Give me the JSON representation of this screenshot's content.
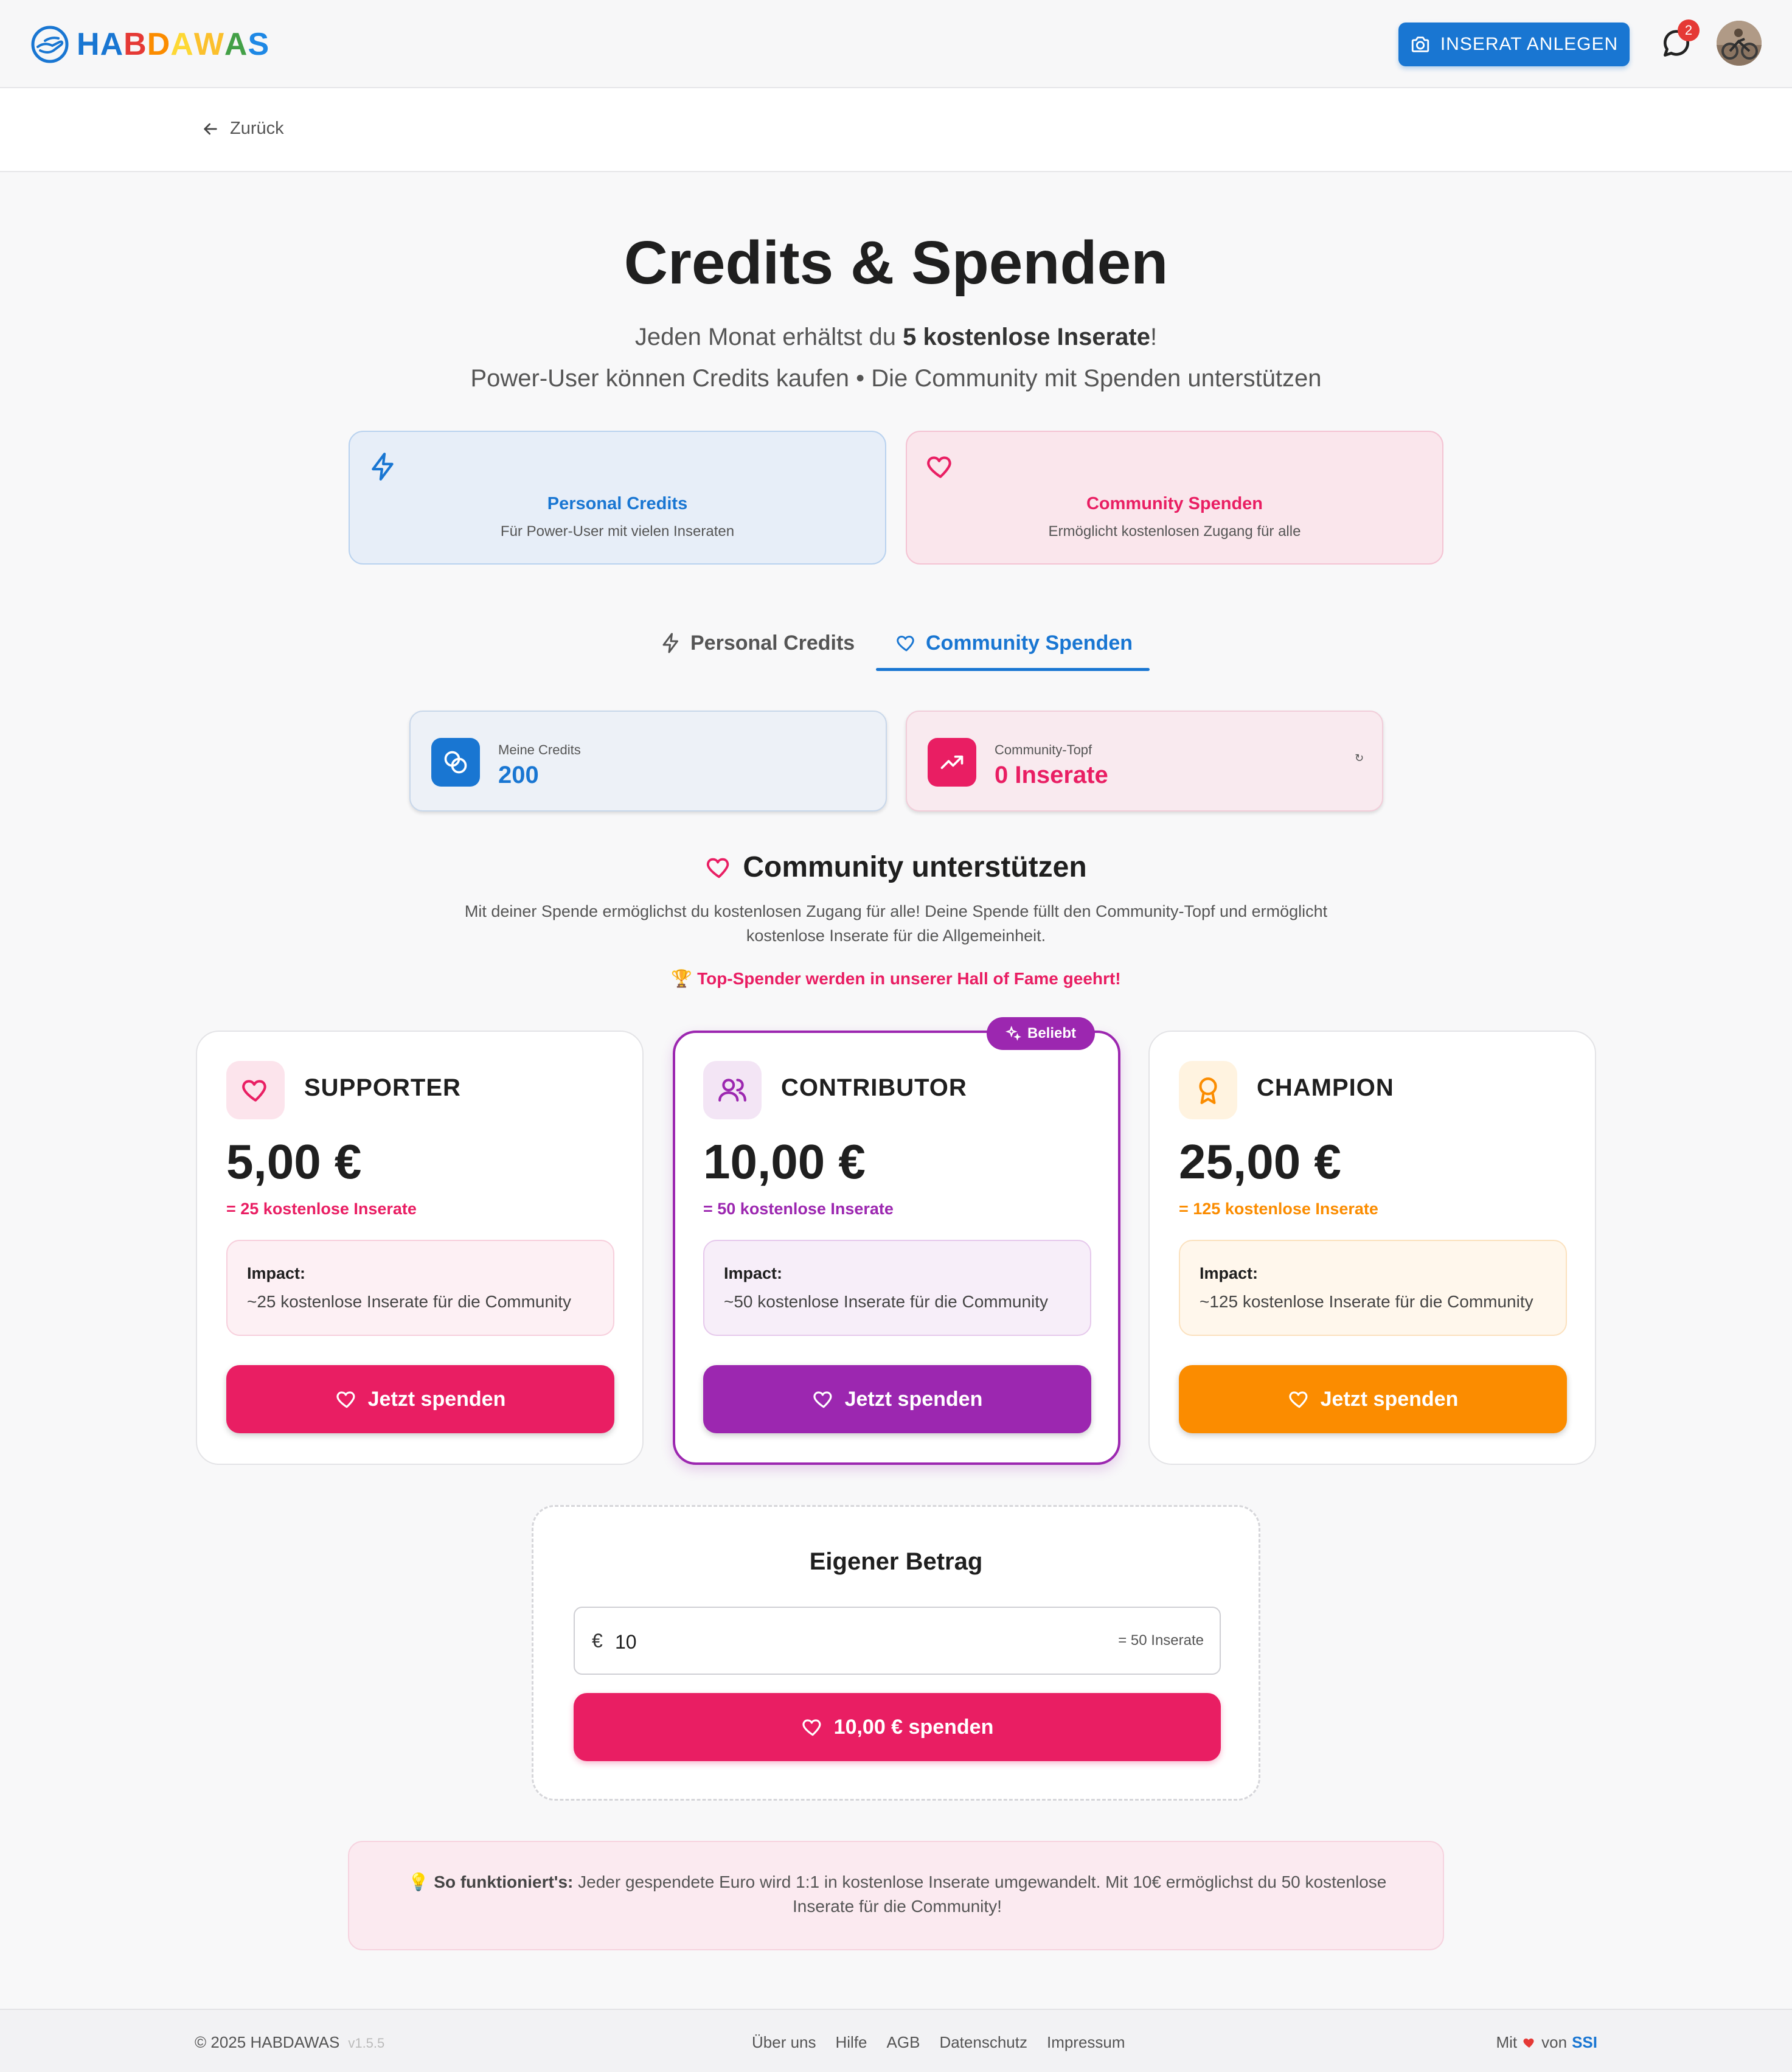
{
  "header": {
    "logo_letters": [
      {
        "ch": "H",
        "color": "#1976d2"
      },
      {
        "ch": "A",
        "color": "#1976d2"
      },
      {
        "ch": "B",
        "color": "#e53935"
      },
      {
        "ch": "D",
        "color": "#fb8c00"
      },
      {
        "ch": "A",
        "color": "#fdd835"
      },
      {
        "ch": "W",
        "color": "#fbc02d"
      },
      {
        "ch": "A",
        "color": "#43a047"
      },
      {
        "ch": "S",
        "color": "#1e88e5"
      }
    ],
    "cta_label": "INSERAT ANLEGEN",
    "messages_badge": "2"
  },
  "nav": {
    "back_label": "Zurück"
  },
  "page": {
    "title": "Credits & Spenden",
    "subtitle_prefix": "Jeden Monat erhältst du ",
    "subtitle_bold": "5 kostenlose Inserate",
    "subtitle_suffix": "!",
    "subtitle2": "Power-User können Credits kaufen • Die Community mit Spenden unterstützen"
  },
  "type_cards": [
    {
      "title": "Personal Credits",
      "subtitle": "Für Power-User mit vielen Inseraten",
      "icon": "lightning-icon",
      "color": "#1976d2"
    },
    {
      "title": "Community Spenden",
      "subtitle": "Ermöglicht kostenlosen Zugang für alle",
      "icon": "heart-icon",
      "color": "#e91e63"
    }
  ],
  "tabs": [
    {
      "label": "Personal Credits",
      "active": false
    },
    {
      "label": "Community Spenden",
      "active": true
    }
  ],
  "stats": {
    "credits_label": "Meine Credits",
    "credits_value": "200",
    "pot_label": "Community-Topf",
    "pot_value": "0 Inserate",
    "pot_refresh_glyph": "↻"
  },
  "section": {
    "title": "Community unterstützen",
    "description": "Mit deiner Spende ermöglichst du kostenlosen Zugang für alle! Deine Spende füllt den Community-Topf und ermöglicht kostenlose Inserate für die Allgemeinheit.",
    "highlight": "🏆 Top-Spender werden in unserer Hall of Fame geehrt!"
  },
  "tiers": [
    {
      "name": "SUPPORTER",
      "price": "5,00 €",
      "note": "= 25 kostenlose Inserate",
      "impact_label": "Impact:",
      "impact_text": "~25 kostenlose Inserate für die Community",
      "button": "Jetzt spenden",
      "color": "#e91e63",
      "icon": "heart-icon"
    },
    {
      "name": "CONTRIBUTOR",
      "price": "10,00 €",
      "note": "= 50 kostenlose Inserate",
      "impact_label": "Impact:",
      "impact_text": "~50 kostenlose Inserate für die Community",
      "button": "Jetzt spenden",
      "color": "#9c27b0",
      "icon": "people-icon",
      "badge": "Beliebt"
    },
    {
      "name": "CHAMPION",
      "price": "25,00 €",
      "note": "= 125 kostenlose Inserate",
      "impact_label": "Impact:",
      "impact_text": "~125 kostenlose Inserate für die Community",
      "button": "Jetzt spenden",
      "color": "#fb8c00",
      "icon": "award-icon"
    }
  ],
  "custom": {
    "title": "Eigener Betrag",
    "currency": "€",
    "value": "10",
    "note": "= 50 Inserate",
    "button": "10,00 € spenden"
  },
  "info": {
    "icon": "💡",
    "bold": "So funktioniert's:",
    "text": " Jeder gespendete Euro wird 1:1 in kostenlose Inserate umgewandelt. Mit 10€ ermöglichst du 50 kostenlose Inserate für die Community!"
  },
  "footer": {
    "copyright": "© 2025 HABDAWAS",
    "version": "v1.5.5",
    "links": [
      "Über uns",
      "Hilfe",
      "AGB",
      "Datenschutz",
      "Impressum"
    ],
    "made_prefix": "Mit",
    "made_middle": "von",
    "made_brand": "SSI"
  }
}
